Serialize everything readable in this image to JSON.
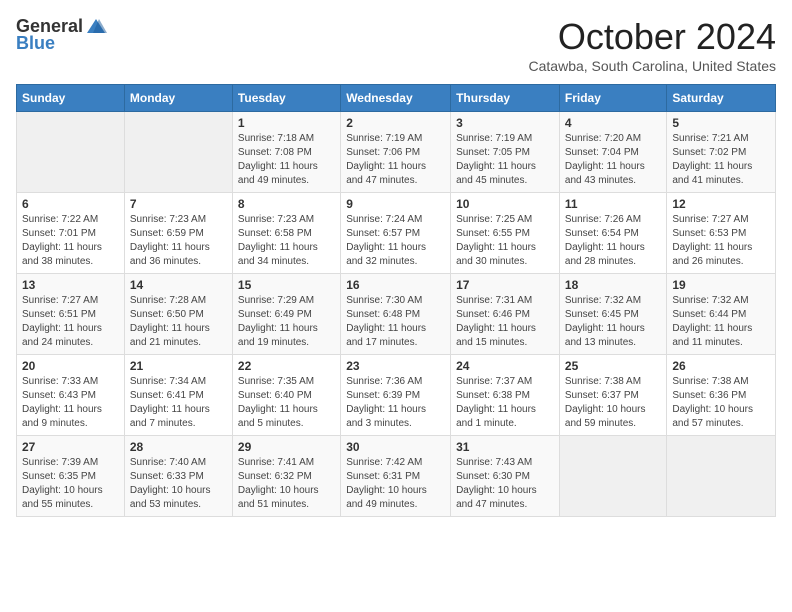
{
  "header": {
    "logo_general": "General",
    "logo_blue": "Blue",
    "month": "October 2024",
    "location": "Catawba, South Carolina, United States"
  },
  "weekdays": [
    "Sunday",
    "Monday",
    "Tuesday",
    "Wednesday",
    "Thursday",
    "Friday",
    "Saturday"
  ],
  "weeks": [
    [
      {
        "day": "",
        "info": ""
      },
      {
        "day": "",
        "info": ""
      },
      {
        "day": "1",
        "info": "Sunrise: 7:18 AM\nSunset: 7:08 PM\nDaylight: 11 hours and 49 minutes."
      },
      {
        "day": "2",
        "info": "Sunrise: 7:19 AM\nSunset: 7:06 PM\nDaylight: 11 hours and 47 minutes."
      },
      {
        "day": "3",
        "info": "Sunrise: 7:19 AM\nSunset: 7:05 PM\nDaylight: 11 hours and 45 minutes."
      },
      {
        "day": "4",
        "info": "Sunrise: 7:20 AM\nSunset: 7:04 PM\nDaylight: 11 hours and 43 minutes."
      },
      {
        "day": "5",
        "info": "Sunrise: 7:21 AM\nSunset: 7:02 PM\nDaylight: 11 hours and 41 minutes."
      }
    ],
    [
      {
        "day": "6",
        "info": "Sunrise: 7:22 AM\nSunset: 7:01 PM\nDaylight: 11 hours and 38 minutes."
      },
      {
        "day": "7",
        "info": "Sunrise: 7:23 AM\nSunset: 6:59 PM\nDaylight: 11 hours and 36 minutes."
      },
      {
        "day": "8",
        "info": "Sunrise: 7:23 AM\nSunset: 6:58 PM\nDaylight: 11 hours and 34 minutes."
      },
      {
        "day": "9",
        "info": "Sunrise: 7:24 AM\nSunset: 6:57 PM\nDaylight: 11 hours and 32 minutes."
      },
      {
        "day": "10",
        "info": "Sunrise: 7:25 AM\nSunset: 6:55 PM\nDaylight: 11 hours and 30 minutes."
      },
      {
        "day": "11",
        "info": "Sunrise: 7:26 AM\nSunset: 6:54 PM\nDaylight: 11 hours and 28 minutes."
      },
      {
        "day": "12",
        "info": "Sunrise: 7:27 AM\nSunset: 6:53 PM\nDaylight: 11 hours and 26 minutes."
      }
    ],
    [
      {
        "day": "13",
        "info": "Sunrise: 7:27 AM\nSunset: 6:51 PM\nDaylight: 11 hours and 24 minutes."
      },
      {
        "day": "14",
        "info": "Sunrise: 7:28 AM\nSunset: 6:50 PM\nDaylight: 11 hours and 21 minutes."
      },
      {
        "day": "15",
        "info": "Sunrise: 7:29 AM\nSunset: 6:49 PM\nDaylight: 11 hours and 19 minutes."
      },
      {
        "day": "16",
        "info": "Sunrise: 7:30 AM\nSunset: 6:48 PM\nDaylight: 11 hours and 17 minutes."
      },
      {
        "day": "17",
        "info": "Sunrise: 7:31 AM\nSunset: 6:46 PM\nDaylight: 11 hours and 15 minutes."
      },
      {
        "day": "18",
        "info": "Sunrise: 7:32 AM\nSunset: 6:45 PM\nDaylight: 11 hours and 13 minutes."
      },
      {
        "day": "19",
        "info": "Sunrise: 7:32 AM\nSunset: 6:44 PM\nDaylight: 11 hours and 11 minutes."
      }
    ],
    [
      {
        "day": "20",
        "info": "Sunrise: 7:33 AM\nSunset: 6:43 PM\nDaylight: 11 hours and 9 minutes."
      },
      {
        "day": "21",
        "info": "Sunrise: 7:34 AM\nSunset: 6:41 PM\nDaylight: 11 hours and 7 minutes."
      },
      {
        "day": "22",
        "info": "Sunrise: 7:35 AM\nSunset: 6:40 PM\nDaylight: 11 hours and 5 minutes."
      },
      {
        "day": "23",
        "info": "Sunrise: 7:36 AM\nSunset: 6:39 PM\nDaylight: 11 hours and 3 minutes."
      },
      {
        "day": "24",
        "info": "Sunrise: 7:37 AM\nSunset: 6:38 PM\nDaylight: 11 hours and 1 minute."
      },
      {
        "day": "25",
        "info": "Sunrise: 7:38 AM\nSunset: 6:37 PM\nDaylight: 10 hours and 59 minutes."
      },
      {
        "day": "26",
        "info": "Sunrise: 7:38 AM\nSunset: 6:36 PM\nDaylight: 10 hours and 57 minutes."
      }
    ],
    [
      {
        "day": "27",
        "info": "Sunrise: 7:39 AM\nSunset: 6:35 PM\nDaylight: 10 hours and 55 minutes."
      },
      {
        "day": "28",
        "info": "Sunrise: 7:40 AM\nSunset: 6:33 PM\nDaylight: 10 hours and 53 minutes."
      },
      {
        "day": "29",
        "info": "Sunrise: 7:41 AM\nSunset: 6:32 PM\nDaylight: 10 hours and 51 minutes."
      },
      {
        "day": "30",
        "info": "Sunrise: 7:42 AM\nSunset: 6:31 PM\nDaylight: 10 hours and 49 minutes."
      },
      {
        "day": "31",
        "info": "Sunrise: 7:43 AM\nSunset: 6:30 PM\nDaylight: 10 hours and 47 minutes."
      },
      {
        "day": "",
        "info": ""
      },
      {
        "day": "",
        "info": ""
      }
    ]
  ]
}
